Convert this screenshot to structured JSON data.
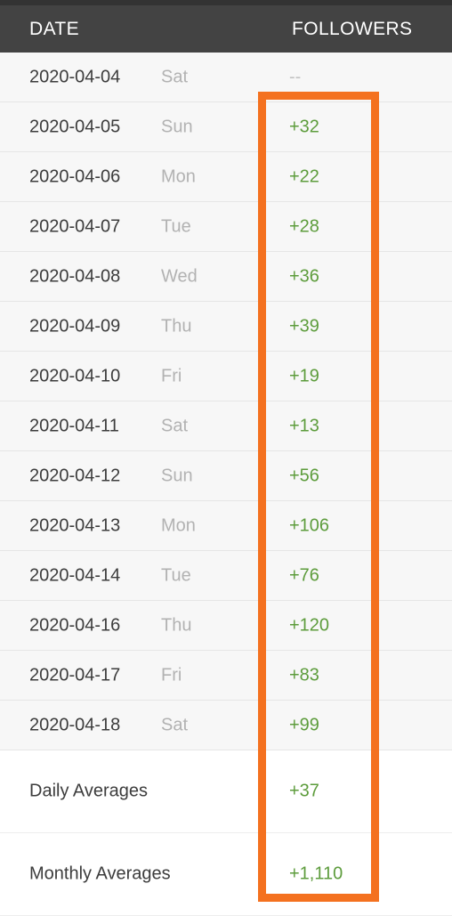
{
  "header": {
    "date_label": "DATE",
    "followers_label": "FOLLOWERS",
    "background_color": "#434343",
    "text_color": "#ffffff"
  },
  "colors": {
    "positive_value": "#5d9c3c",
    "empty_value": "#c2c2c2",
    "highlight_outline": "#f4711f",
    "row_background": "#f7f7f7",
    "summary_background": "#ffffff",
    "date_text": "#3c3c3c",
    "weekday_text": "#b2b2b2"
  },
  "highlight": {
    "name": "followers-column-highlight",
    "color": "#f4711f"
  },
  "table": {
    "columns": [
      "DATE",
      "",
      "FOLLOWERS"
    ],
    "rows": [
      {
        "date": "2020-04-04",
        "day": "Sat",
        "followers": "--"
      },
      {
        "date": "2020-04-05",
        "day": "Sun",
        "followers": "+32"
      },
      {
        "date": "2020-04-06",
        "day": "Mon",
        "followers": "+22"
      },
      {
        "date": "2020-04-07",
        "day": "Tue",
        "followers": "+28"
      },
      {
        "date": "2020-04-08",
        "day": "Wed",
        "followers": "+36"
      },
      {
        "date": "2020-04-09",
        "day": "Thu",
        "followers": "+39"
      },
      {
        "date": "2020-04-10",
        "day": "Fri",
        "followers": "+19"
      },
      {
        "date": "2020-04-11",
        "day": "Sat",
        "followers": "+13"
      },
      {
        "date": "2020-04-12",
        "day": "Sun",
        "followers": "+56"
      },
      {
        "date": "2020-04-13",
        "day": "Mon",
        "followers": "+106"
      },
      {
        "date": "2020-04-14",
        "day": "Tue",
        "followers": "+76"
      },
      {
        "date": "2020-04-16",
        "day": "Thu",
        "followers": "+120"
      },
      {
        "date": "2020-04-17",
        "day": "Fri",
        "followers": "+83"
      },
      {
        "date": "2020-04-18",
        "day": "Sat",
        "followers": "+99"
      }
    ],
    "summary": [
      {
        "label": "Daily Averages",
        "followers": "+37"
      },
      {
        "label": "Monthly Averages",
        "followers": "+1,110"
      }
    ]
  }
}
